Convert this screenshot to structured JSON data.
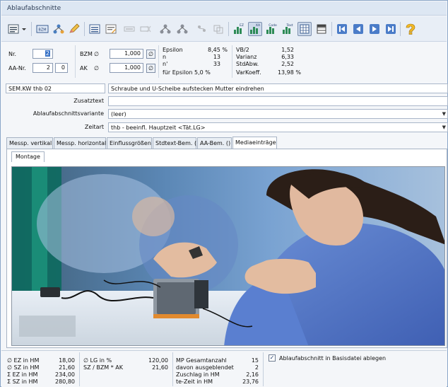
{
  "window": {
    "title": "Ablaufabschnitte"
  },
  "toolbar": {
    "labels": {
      "bzm": "BZM",
      "ez": "EZ",
      "xa": "XA",
      "code": "Code",
      "text": "Text"
    }
  },
  "header": {
    "nr_label": "Nr.",
    "nr_value": "2",
    "aanr_label": "AA-Nr.",
    "aanr_value1": "2",
    "aanr_value2": "0",
    "bzm_label": "BZM",
    "ak_label": "AK",
    "avg_symbol": "∅",
    "bzm_value": "1,000",
    "ak_value": "1,000",
    "stats_left": [
      {
        "label": "Epsilon",
        "value": "8,45 %"
      },
      {
        "label": "n",
        "value": "13"
      },
      {
        "label": "n'",
        "value": "33"
      }
    ],
    "epsilon_note": "für Epsilon  5,0 %",
    "stats_right": [
      {
        "label": "VB/2",
        "value": "1,52"
      },
      {
        "label": "Varianz",
        "value": "6,33"
      },
      {
        "label": "StdAbw.",
        "value": "2,52"
      },
      {
        "label": "VarKoeff.",
        "value": "13,98 %"
      }
    ]
  },
  "form": {
    "code": "SEM.KW thb 02",
    "description": "Schraube und U-Scheibe aufstecken Mutter eindrehen",
    "zusatztext_label": "Zusatztext",
    "zusatztext_value": "",
    "variante_label": "Ablaufabschnittsvariante",
    "variante_value": "(leer)",
    "zeitart_label": "Zeitart",
    "zeitart_value": "thb - beeinfl. Hauptzeit   <Tät.LG>"
  },
  "tabs": [
    {
      "label": "Messp. vertikal"
    },
    {
      "label": "Messp. horizontal"
    },
    {
      "label": "Einflussgrößen"
    },
    {
      "label": "Stdtext-Bem. ()"
    },
    {
      "label": "AA-Bem. ()"
    },
    {
      "label": "Mediaeinträge",
      "active": true
    }
  ],
  "media": {
    "subtab": "Montage"
  },
  "summary": {
    "col1": [
      {
        "label": "∅ EZ in HM",
        "value": "18,00"
      },
      {
        "label": "∅ SZ in HM",
        "value": "21,60"
      },
      {
        "label": "Σ EZ in HM",
        "value": "234,00"
      },
      {
        "label": "Σ SZ in HM",
        "value": "280,80"
      }
    ],
    "col2": [
      {
        "label": "∅ LG in %",
        "value": "120,00"
      },
      {
        "label": "SZ / BZM * AK",
        "value": "21,60"
      }
    ],
    "col3": [
      {
        "label": "MP Gesamtanzahl",
        "value": "15"
      },
      {
        "label": "davon ausgeblendet",
        "value": "2"
      },
      {
        "label": "Zuschlag in HM",
        "value": "2,16"
      },
      {
        "label": "te-Zeit in HM",
        "value": "23,76"
      }
    ],
    "checkbox_label": "Ablaufabschnitt in Basisdatei ablegen",
    "checkbox_checked": "✓"
  }
}
